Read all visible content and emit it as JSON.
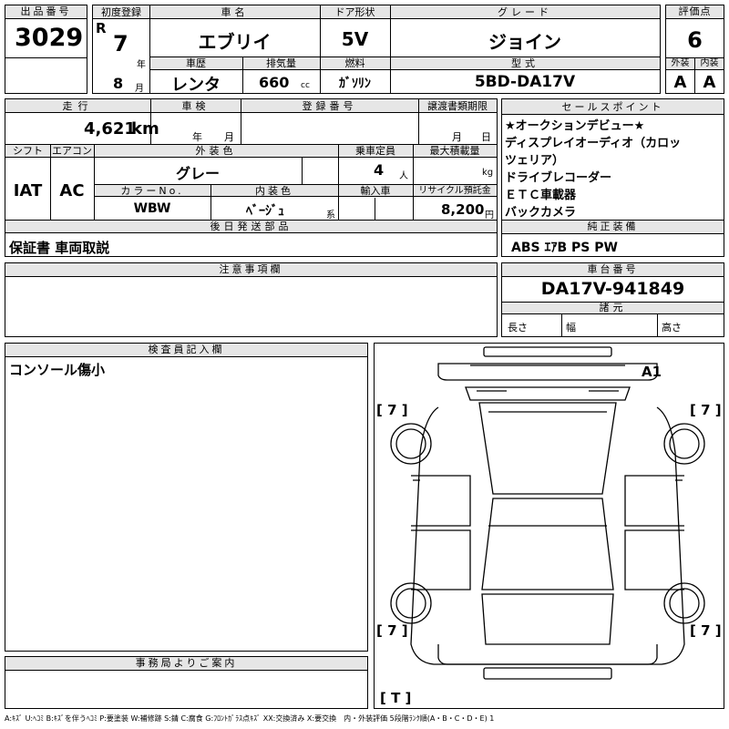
{
  "header": {
    "lot_no_label": "出品番号",
    "lot_no": "3029",
    "first_reg_label": "初度登録",
    "era": "R",
    "year": "7",
    "year_unit": "年",
    "month": "8",
    "month_unit": "月",
    "car_name_label": "車名",
    "car_name": "エブリイ",
    "door_label": "ドア形状",
    "door": "5V",
    "grade_label": "グレード",
    "grade": "ジョイン",
    "score_label": "評価点",
    "score": "6",
    "history_label": "車歴",
    "history": "レンタ",
    "displacement_label": "排気量",
    "displacement": "660",
    "displacement_unit": "cc",
    "fuel_label": "燃料",
    "fuel": "ｶﾞｿﾘﾝ",
    "model_label": "型式",
    "model": "5BD-DA17V",
    "exterior_label": "外装",
    "exterior": "A",
    "interior_label": "内装",
    "interior": "A"
  },
  "row2": {
    "mileage_label": "走行",
    "mileage": "4,621",
    "mileage_unit": "km",
    "inspection_label": "車検",
    "ins_year_unit": "年",
    "ins_month_unit": "月",
    "reg_no_label": "登録番号",
    "transfer_label": "譲渡書類期限",
    "tr_month_unit": "月",
    "tr_day_unit": "日",
    "shift_label": "シフト",
    "shift": "IAT",
    "ac_label": "エアコン",
    "ac": "AC",
    "color_label": "外装色",
    "color": "グレー",
    "capacity_label": "乗車定員",
    "capacity": "4",
    "capacity_unit": "人",
    "load_label": "最大積載量",
    "load_unit": "kg",
    "color_no_label": "カラーNo.",
    "color_no": "WBW",
    "int_color_label": "内装色",
    "int_color": "ﾍﾞｰｼﾞｭ",
    "int_color_unit": "系",
    "import_label": "輸入車",
    "recycle_label": "リサイクル預託金",
    "recycle": "8,200",
    "recycle_unit": "円",
    "later_label": "後日発送部品",
    "later": "保証書 車両取説"
  },
  "sales": {
    "label": "セールスポイント",
    "lines": [
      "★オークションデビュー★",
      "ディスプレイオーディオ（カロッ",
      "ツェリア）",
      "ドライブレコーダー",
      "ＥＴＣ車載器",
      "バックカメラ"
    ]
  },
  "equipment": {
    "label": "純正装備",
    "value": "ABS ｴｱB PS PW"
  },
  "notes": {
    "label": "注意事項欄"
  },
  "chassis": {
    "label": "車台番号",
    "value": "DA17V-941849",
    "dims_label": "諸元",
    "length_label": "長さ",
    "width_label": "幅",
    "height_label": "高さ"
  },
  "inspector": {
    "label": "検査員記入欄",
    "comment": "コンソール傷小"
  },
  "office": {
    "label": "事務局よりご案内"
  },
  "diagram": {
    "mark_a1": "A1",
    "fl": "[ 7 ]",
    "fr": "[ 7 ]",
    "rl": "[ 7 ]",
    "rr": "[ 7 ]",
    "tire": "[ T ]"
  },
  "legend": "A:ｷｽﾞ U:ﾍｺﾐ B:ｷｽﾞを伴うﾍｺﾐ P:要塗装 W:補修跡 S:錆 C:腐食 G:ﾌﾛﾝﾄｶﾞﾗｽ点ｷｽﾞ XX:交換済み X:要交換　内・外装評価 5段階ﾗﾝｸ順(A・B・C・D・E) 1"
}
